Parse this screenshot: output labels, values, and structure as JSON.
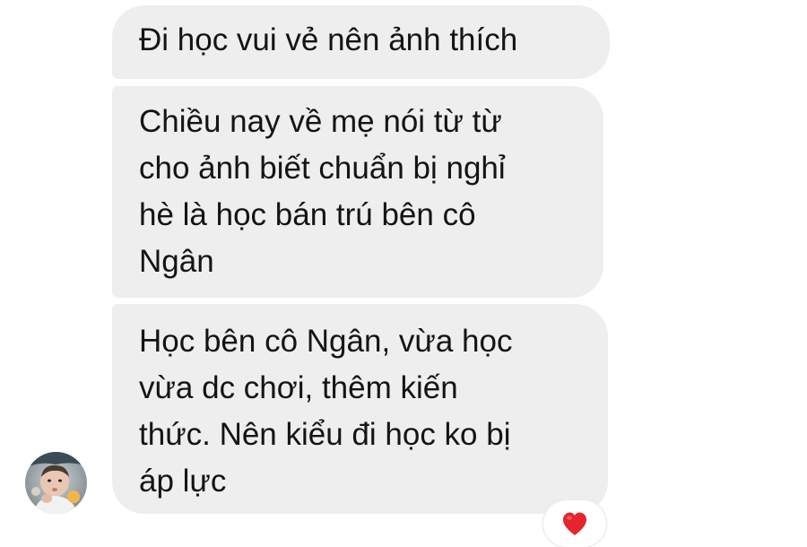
{
  "messages": [
    {
      "text": "Đi học vui vẻ nên ảnh thích"
    },
    {
      "text": "Chiều nay về mẹ nói từ từ\ncho ảnh biết chuẩn bị nghỉ\nhè là học bán trú bên cô\nNgân"
    },
    {
      "text": "Học bên cô Ngân, vừa học\nvừa dc chơi, thêm kiến\nthức. Nên kiểu đi học ko bị\náp lực"
    }
  ],
  "reaction": {
    "icon": "heart-icon",
    "color": "#e5242e"
  },
  "avatar": {
    "icon": "baby-photo-avatar"
  },
  "colors": {
    "bubble": "#eeeeee",
    "text": "#141414",
    "background": "#ffffff"
  }
}
